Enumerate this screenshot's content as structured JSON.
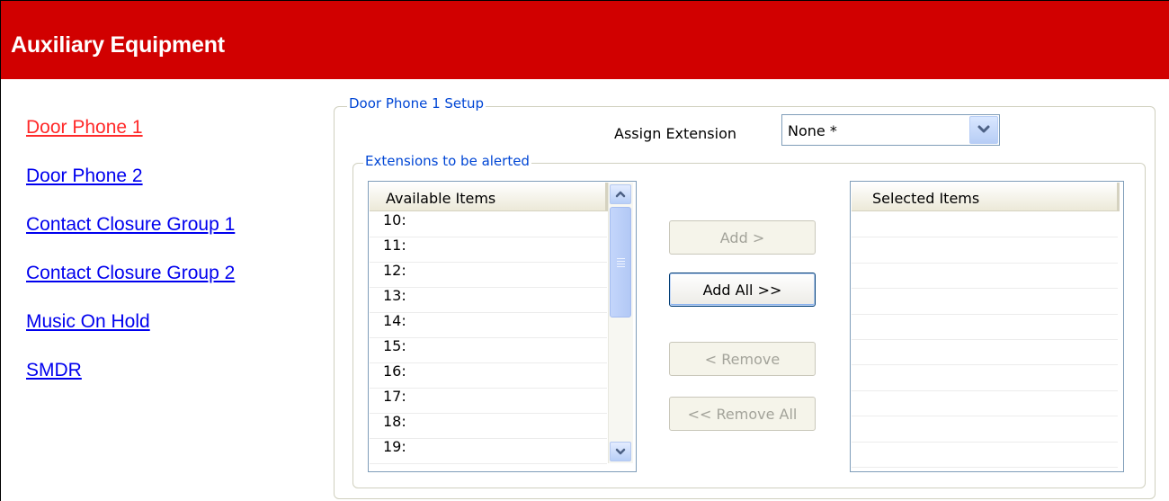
{
  "header": {
    "title": "Auxiliary Equipment"
  },
  "nav": {
    "items": [
      {
        "label": "Door Phone 1",
        "active": true
      },
      {
        "label": "Door Phone 2",
        "active": false
      },
      {
        "label": "Contact Closure Group 1",
        "active": false
      },
      {
        "label": "Contact Closure Group 2",
        "active": false
      },
      {
        "label": "Music On Hold",
        "active": false
      },
      {
        "label": "SMDR",
        "active": false
      }
    ]
  },
  "setup": {
    "legend": "Door Phone 1 Setup",
    "assign_label": "Assign Extension",
    "assign_value": "None *",
    "alert_legend": "Extensions to be alerted"
  },
  "available": {
    "header": "Available Items",
    "items": [
      "10:",
      "11:",
      "12:",
      "13:",
      "14:",
      "15:",
      "16:",
      "17:",
      "18:",
      "19:"
    ]
  },
  "selected": {
    "header": "Selected Items",
    "items": []
  },
  "buttons": {
    "add": {
      "label": "Add >",
      "enabled": false
    },
    "add_all": {
      "label": "Add All >>",
      "enabled": true
    },
    "remove": {
      "label": "< Remove",
      "enabled": false
    },
    "remove_all": {
      "label": "<< Remove All",
      "enabled": false
    }
  },
  "colors": {
    "header_bg": "#d10000",
    "link": "#0000ee",
    "link_active": "#ff2a2a",
    "legend": "#0046d5"
  },
  "icons": [
    "chevron-down-icon",
    "scroll-up-icon",
    "scroll-down-icon",
    "scroll-grip-icon"
  ]
}
